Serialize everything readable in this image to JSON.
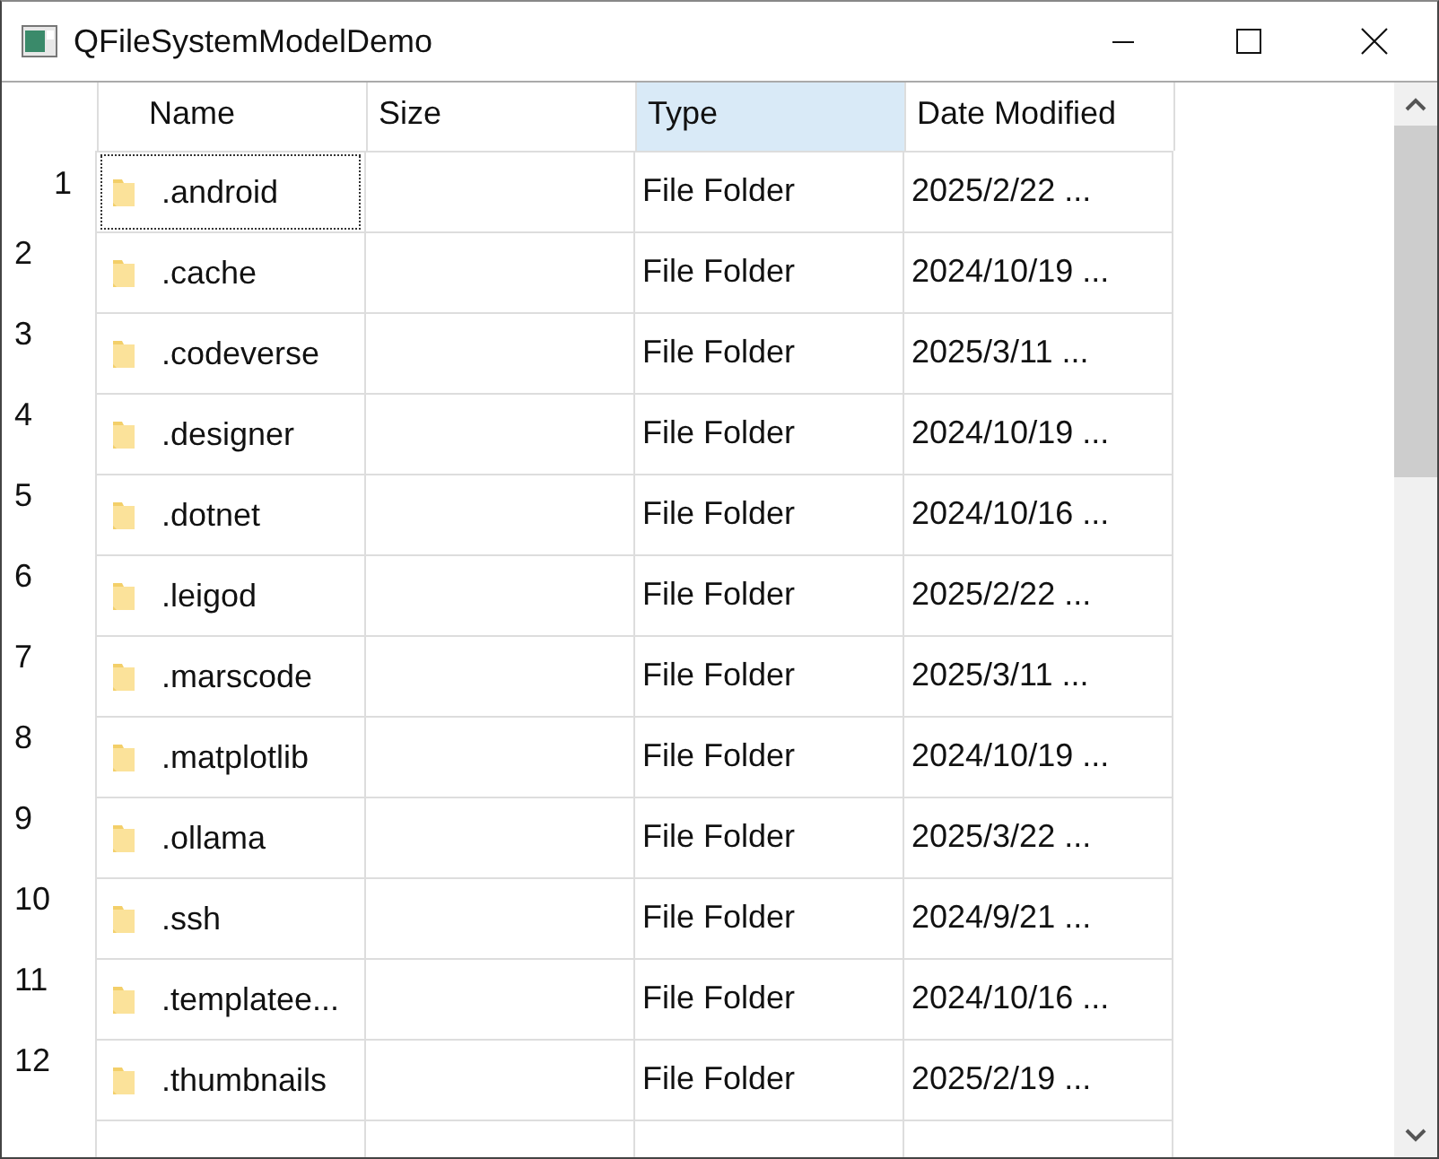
{
  "window": {
    "title": "QFileSystemModelDemo"
  },
  "table": {
    "columns": [
      {
        "label": "Name",
        "selected": false
      },
      {
        "label": "Size",
        "selected": false
      },
      {
        "label": "Type",
        "selected": true
      },
      {
        "label": "Date Modified",
        "selected": false
      }
    ],
    "rows": [
      {
        "number": "1",
        "name": ".android",
        "size": "",
        "type": "File Folder",
        "date": "2025/2/22 ...",
        "current": true
      },
      {
        "number": "2",
        "name": ".cache",
        "type": "File Folder",
        "date": "2024/10/19 ...",
        "current": false
      },
      {
        "number": "3",
        "name": ".codeverse",
        "type": "File Folder",
        "date": "2025/3/11 ...",
        "current": false
      },
      {
        "number": "4",
        "name": ".designer",
        "type": "File Folder",
        "date": "2024/10/19 ...",
        "current": false
      },
      {
        "number": "5",
        "name": ".dotnet",
        "type": "File Folder",
        "date": "2024/10/16 ...",
        "current": false
      },
      {
        "number": "6",
        "name": ".leigod",
        "type": "File Folder",
        "date": "2025/2/22 ...",
        "current": false
      },
      {
        "number": "7",
        "name": ".marscode",
        "type": "File Folder",
        "date": "2025/3/11 ...",
        "current": false
      },
      {
        "number": "8",
        "name": ".matplotlib",
        "type": "File Folder",
        "date": "2024/10/19 ...",
        "current": false
      },
      {
        "number": "9",
        "name": ".ollama",
        "type": "File Folder",
        "date": "2025/3/22 ...",
        "current": false
      },
      {
        "number": "10",
        "name": ".ssh",
        "type": "File Folder",
        "date": "2024/9/21 ...",
        "current": false
      },
      {
        "number": "11",
        "name": ".templatee...",
        "type": "File Folder",
        "date": "2024/10/16 ...",
        "current": false
      },
      {
        "number": "12",
        "name": ".thumbnails",
        "type": "File Folder",
        "date": "2025/2/19 ...",
        "current": false
      }
    ]
  }
}
